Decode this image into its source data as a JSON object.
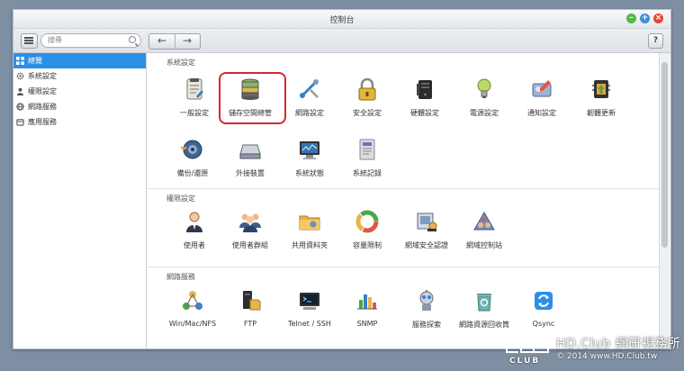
{
  "window": {
    "title": "控制台"
  },
  "toolbar": {
    "search_placeholder": "搜尋",
    "help": "?"
  },
  "sidebar": {
    "items": [
      {
        "label": "總覽",
        "active": true,
        "icon": "overview-grid-icon"
      },
      {
        "label": "系統設定",
        "active": false,
        "icon": "gear-icon"
      },
      {
        "label": "權限設定",
        "active": false,
        "icon": "user-icon"
      },
      {
        "label": "網路服務",
        "active": false,
        "icon": "globe-icon"
      },
      {
        "label": "應用服務",
        "active": false,
        "icon": "apps-icon"
      }
    ]
  },
  "sections": [
    {
      "title": "系統設定",
      "apps": [
        {
          "label": "一般設定",
          "icon": "general-settings-icon"
        },
        {
          "label": "儲存空間總管",
          "icon": "storage-manager-icon",
          "highlighted": true
        },
        {
          "label": "網路設定",
          "icon": "network-settings-icon"
        },
        {
          "label": "安全設定",
          "icon": "security-lock-icon"
        },
        {
          "label": "硬體設定",
          "icon": "hardware-icon"
        },
        {
          "label": "電源設定",
          "icon": "power-bulb-icon"
        },
        {
          "label": "通知設定",
          "icon": "notification-icon"
        },
        {
          "label": "韌體更新",
          "icon": "firmware-update-icon"
        },
        {
          "label": "備份/還原",
          "icon": "backup-restore-icon"
        },
        {
          "label": "外接裝置",
          "icon": "external-device-icon"
        },
        {
          "label": "系統狀態",
          "icon": "system-status-icon"
        },
        {
          "label": "系統記錄",
          "icon": "system-log-icon"
        }
      ]
    },
    {
      "title": "權限設定",
      "apps": [
        {
          "label": "使用者",
          "icon": "user-icon"
        },
        {
          "label": "使用者群組",
          "icon": "user-group-icon"
        },
        {
          "label": "共用資料夾",
          "icon": "shared-folder-icon"
        },
        {
          "label": "容量限制",
          "icon": "quota-icon"
        },
        {
          "label": "網域安全認證",
          "icon": "domain-security-icon"
        },
        {
          "label": "網域控制站",
          "icon": "domain-controller-icon"
        }
      ]
    },
    {
      "title": "網路服務",
      "apps": [
        {
          "label": "Win/Mac/NFS",
          "icon": "win-mac-nfs-icon"
        },
        {
          "label": "FTP",
          "icon": "ftp-icon"
        },
        {
          "label": "Telnet / SSH",
          "icon": "terminal-icon"
        },
        {
          "label": "SNMP",
          "icon": "snmp-chart-icon"
        },
        {
          "label": "服務探索",
          "icon": "service-discovery-icon"
        },
        {
          "label": "網路資源回收筒",
          "icon": "network-recycle-bin-icon"
        },
        {
          "label": "Qsync",
          "icon": "qsync-icon"
        }
      ]
    }
  ],
  "watermark": {
    "title": "HD.Club 網研視務所",
    "copyright": "© 2014 www.HD.Club.tw",
    "logo_text": "CLUB"
  }
}
